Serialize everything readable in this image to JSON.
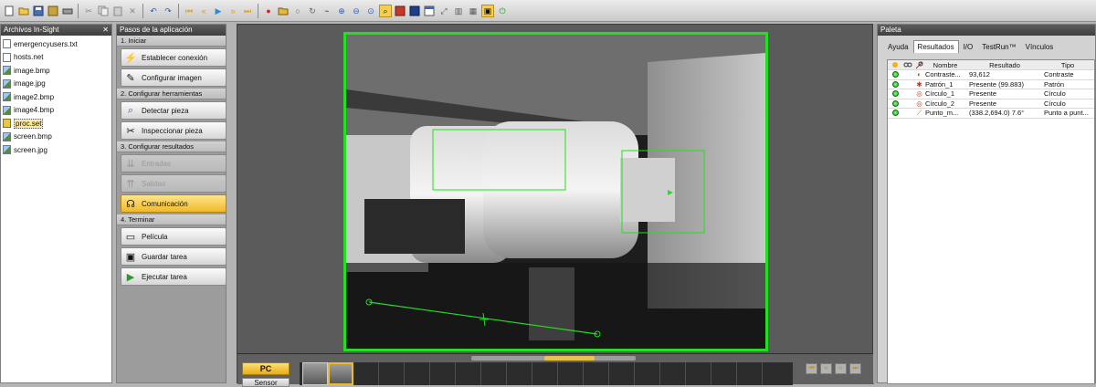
{
  "toolbar": {
    "icons": [
      "new-icon",
      "open-icon",
      "save-icon",
      "save-all-icon",
      "print-icon",
      "cut-icon",
      "copy-icon",
      "paste-icon",
      "delete-icon",
      "undo-icon",
      "redo-icon",
      "first-icon",
      "previous-icon",
      "play-icon",
      "next-icon",
      "last-icon",
      "record-icon",
      "open-image-icon",
      "circle-tool-icon",
      "rotate-icon",
      "link-icon",
      "zoom-in-icon",
      "zoom-out-icon",
      "zoom-fit-icon",
      "zoom-active-icon",
      "image-mode-icon",
      "image-icon",
      "window-icon",
      "resize-icon",
      "histogram-icon",
      "grid-icon",
      "camera-icon",
      "online-icon"
    ],
    "accent": "#f6cf52"
  },
  "files_panel": {
    "title": "Archivos In-Sight",
    "close": "✕",
    "items": [
      {
        "name": "emergencyusers.txt",
        "kind": "txt"
      },
      {
        "name": "hosts.net",
        "kind": "txt"
      },
      {
        "name": "image.bmp",
        "kind": "img"
      },
      {
        "name": "image.jpg",
        "kind": "img"
      },
      {
        "name": "image2.bmp",
        "kind": "img"
      },
      {
        "name": "image4.bmp",
        "kind": "img"
      },
      {
        "name": "proc.set",
        "kind": "job",
        "selected": true
      },
      {
        "name": "screen.bmp",
        "kind": "img"
      },
      {
        "name": "screen.jpg",
        "kind": "img"
      }
    ]
  },
  "steps_panel": {
    "title": "Pasos de la aplicación",
    "groups": [
      {
        "head": "1. Iniciar",
        "items": [
          {
            "label": "Establecer conexión",
            "icon": "connect-icon",
            "state": "normal"
          },
          {
            "label": "Configurar imagen",
            "icon": "image-setup-icon",
            "state": "normal"
          }
        ]
      },
      {
        "head": "2. Configurar herramientas",
        "items": [
          {
            "label": "Detectar pieza",
            "icon": "magnifier-icon",
            "state": "normal"
          },
          {
            "label": "Inspeccionar pieza",
            "icon": "tools-icon",
            "state": "normal"
          }
        ]
      },
      {
        "head": "3. Configurar resultados",
        "items": [
          {
            "label": "Entradas",
            "icon": "inputs-icon",
            "state": "disabled"
          },
          {
            "label": "Salidas",
            "icon": "outputs-icon",
            "state": "disabled"
          },
          {
            "label": "Comunicación",
            "icon": "communication-icon",
            "state": "active"
          }
        ]
      },
      {
        "head": "4. Terminar",
        "items": [
          {
            "label": "Película",
            "icon": "film-icon",
            "state": "normal"
          },
          {
            "label": "Guardar tarea",
            "icon": "save-job-icon",
            "state": "normal"
          },
          {
            "label": "Ejecutar tarea",
            "icon": "run-job-icon",
            "state": "normal"
          }
        ]
      }
    ]
  },
  "center": {
    "overlay_color": "#20e020",
    "filmstrip": {
      "pc_label": "PC",
      "sensor_label": "Sensor"
    }
  },
  "palette": {
    "title": "Paleta",
    "tabs": [
      {
        "label": "Ayuda",
        "active": false
      },
      {
        "label": "Resultados",
        "active": true
      },
      {
        "label": "I/O",
        "active": false
      },
      {
        "label": "TestRun™",
        "active": false
      },
      {
        "label": "Vínculos",
        "active": false
      }
    ],
    "columns": {
      "name": "Nombre",
      "result": "Resultado",
      "type": "Tipo"
    },
    "rows": [
      {
        "name": "Contraste...",
        "result": "93,612",
        "type": "Contraste",
        "icon": "contrast-tool-icon"
      },
      {
        "name": "Patrón_1",
        "result": "Presente (99.883)",
        "type": "Patrón",
        "icon": "pattern-tool-icon"
      },
      {
        "name": "Círculo_1",
        "result": "Presente",
        "type": "Círculo",
        "icon": "circle-tool-icon"
      },
      {
        "name": "Círculo_2",
        "result": "Presente",
        "type": "Círculo",
        "icon": "circle-tool-icon"
      },
      {
        "name": "Punto_m...",
        "result": "(338.2,694.0) 7.6°",
        "type": "Punto a punt...",
        "icon": "point-tool-icon"
      }
    ]
  }
}
